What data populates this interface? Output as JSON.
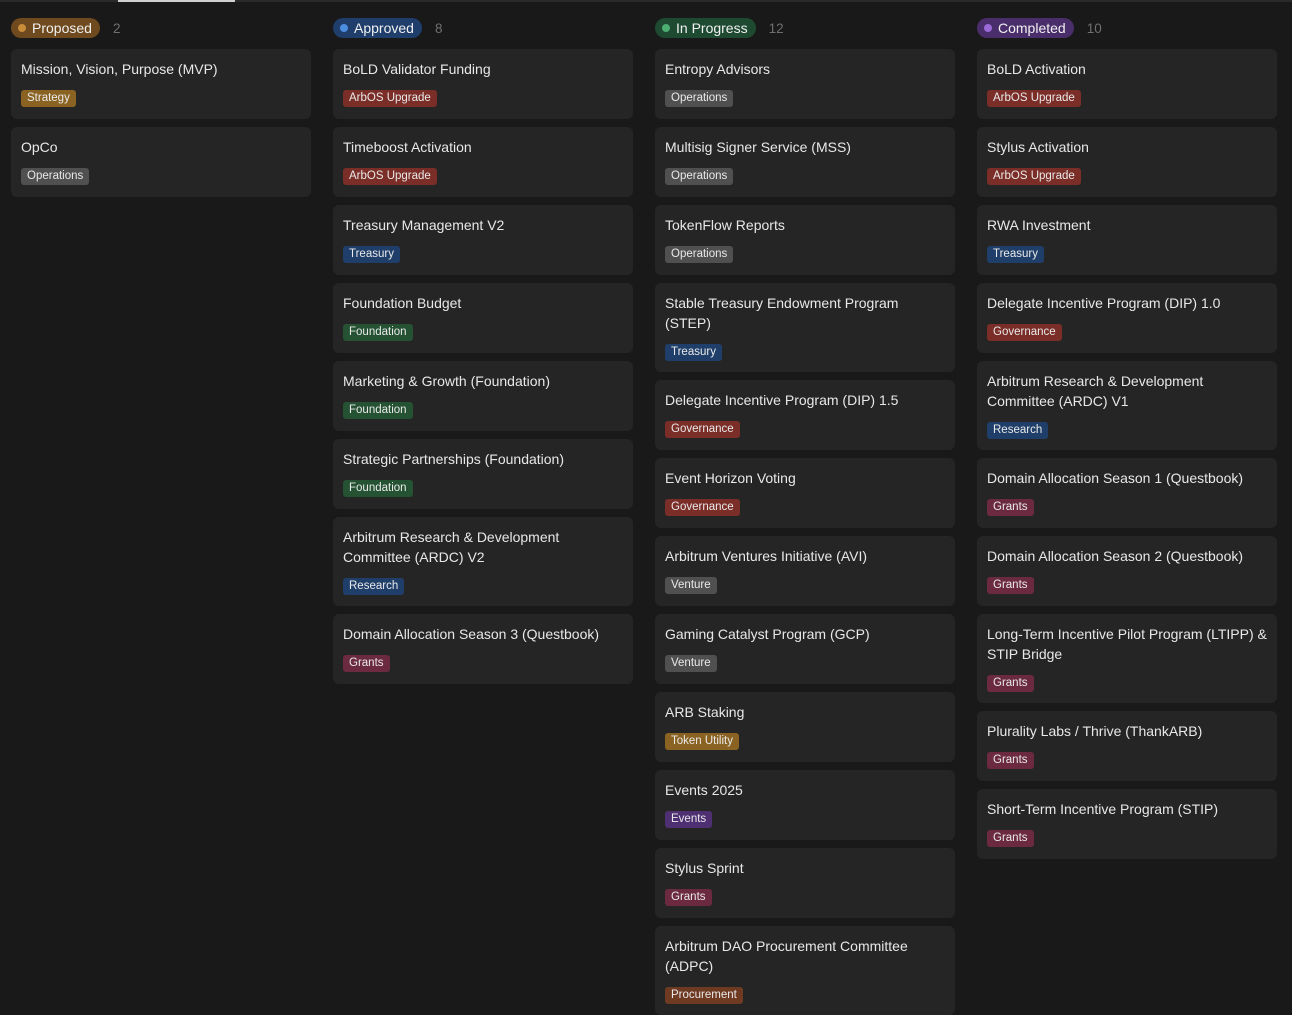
{
  "columns": [
    {
      "status": "Proposed",
      "count": "2",
      "pill_color": "#6e4a1e",
      "dot_color": "#c98d3a",
      "cards": [
        {
          "title": "Mission, Vision, Purpose (MVP)",
          "tag": "Strategy"
        },
        {
          "title": "OpCo",
          "tag": "Operations"
        }
      ]
    },
    {
      "status": "Approved",
      "count": "8",
      "pill_color": "#1f3e6b",
      "dot_color": "#4d8de0",
      "cards": [
        {
          "title": "BoLD Validator Funding",
          "tag": "ArbOS Upgrade"
        },
        {
          "title": "Timeboost Activation",
          "tag": "ArbOS Upgrade"
        },
        {
          "title": "Treasury Management V2",
          "tag": "Treasury"
        },
        {
          "title": "Foundation Budget",
          "tag": "Foundation"
        },
        {
          "title": "Marketing & Growth (Foundation)",
          "tag": "Foundation"
        },
        {
          "title": "Strategic Partnerships (Foundation)",
          "tag": "Foundation"
        },
        {
          "title": "Arbitrum Research & Development Committee (ARDC) V2",
          "tag": "Research"
        },
        {
          "title": "Domain Allocation Season 3 (Questbook)",
          "tag": "Grants"
        }
      ]
    },
    {
      "status": "In Progress",
      "count": "12",
      "pill_color": "#1f4a32",
      "dot_color": "#4cae70",
      "cards": [
        {
          "title": "Entropy Advisors",
          "tag": "Operations"
        },
        {
          "title": "Multisig Signer Service (MSS)",
          "tag": "Operations"
        },
        {
          "title": "TokenFlow Reports",
          "tag": "Operations"
        },
        {
          "title": "Stable Treasury Endowment Program (STEP)",
          "tag": "Treasury"
        },
        {
          "title": "Delegate Incentive Program (DIP) 1.5",
          "tag": "Governance"
        },
        {
          "title": "Event Horizon Voting",
          "tag": "Governance"
        },
        {
          "title": "Arbitrum Ventures Initiative (AVI)",
          "tag": "Venture"
        },
        {
          "title": "Gaming Catalyst Program (GCP)",
          "tag": "Venture"
        },
        {
          "title": "ARB Staking",
          "tag": "Token Utility"
        },
        {
          "title": "Events 2025",
          "tag": "Events"
        },
        {
          "title": "Stylus Sprint",
          "tag": "Grants"
        },
        {
          "title": "Arbitrum DAO Procurement Committee (ADPC)",
          "tag": "Procurement"
        }
      ]
    },
    {
      "status": "Completed",
      "count": "10",
      "pill_color": "#4a2e6b",
      "dot_color": "#9a6ad6",
      "cards": [
        {
          "title": "BoLD Activation",
          "tag": "ArbOS Upgrade"
        },
        {
          "title": "Stylus Activation",
          "tag": "ArbOS Upgrade"
        },
        {
          "title": "RWA Investment",
          "tag": "Treasury"
        },
        {
          "title": "Delegate Incentive Program (DIP) 1.0",
          "tag": "Governance"
        },
        {
          "title": "Arbitrum Research & Development Committee (ARDC) V1",
          "tag": "Research"
        },
        {
          "title": "Domain Allocation Season 1 (Questbook)",
          "tag": "Grants"
        },
        {
          "title": "Domain Allocation Season 2 (Questbook)",
          "tag": "Grants"
        },
        {
          "title": "Long-Term Incentive Pilot Program (LTIPP) & STIP Bridge",
          "tag": "Grants"
        },
        {
          "title": "Plurality Labs / Thrive (ThankARB)",
          "tag": "Grants"
        },
        {
          "title": "Short-Term Incentive Program (STIP)",
          "tag": "Grants"
        }
      ]
    }
  ],
  "tag_colors": {
    "Strategy": "#8a6322",
    "Operations": "#505050",
    "ArbOS Upgrade": "#7a2e27",
    "Treasury": "#1f3f6a",
    "Foundation": "#245233",
    "Research": "#1f3f6a",
    "Grants": "#6b2a40",
    "Governance": "#7a2e27",
    "Venture": "#505050",
    "Token Utility": "#8a6322",
    "Events": "#4e2f72",
    "Procurement": "#6e3a22"
  }
}
